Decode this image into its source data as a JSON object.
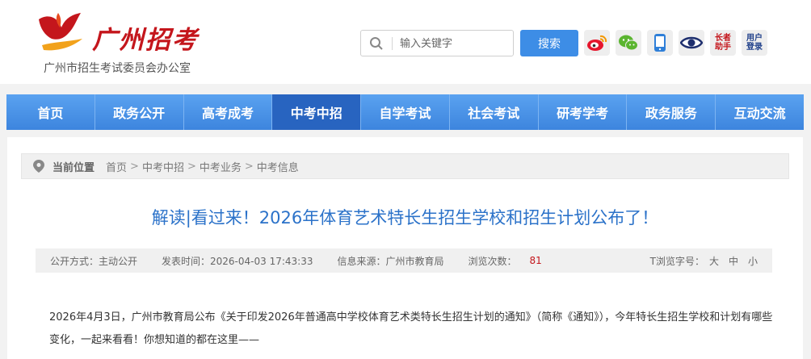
{
  "header": {
    "logo_title": "广州招考",
    "logo_subtitle": "广州市招生考试委员会办公室",
    "search_placeholder": "输入关键字",
    "search_button": "搜索",
    "icons": [
      "weibo-icon",
      "wechat-icon",
      "mobile-icon",
      "eye-icon"
    ],
    "helper_label_top": "长者",
    "helper_label_bottom": "助手",
    "login_label_top": "用户",
    "login_label_bottom": "登录"
  },
  "nav": {
    "items": [
      "首页",
      "政务公开",
      "高考成考",
      "中考中招",
      "自学考试",
      "社会考试",
      "研考学考",
      "政务服务",
      "互动交流"
    ],
    "active_index": 3
  },
  "breadcrumb": {
    "label": "当前位置",
    "items": [
      "首页",
      "中考中招",
      "中考业务",
      "中考信息"
    ],
    "separator": ">"
  },
  "article": {
    "title": "解读|看过来！2026年体育艺术特长生招生学校和招生计划公布了！",
    "meta": {
      "disclosure": "公开方式：主动公开",
      "publish_time": "发表时间：2026-04-03 17:43:33",
      "source": "信息来源：广州市教育局",
      "views_label": "浏览次数：",
      "views": "81",
      "font_label": "T浏览字号：",
      "font_sizes": [
        "大",
        "中",
        "小"
      ]
    },
    "body": "2026年4月3日，广州市教育局公布《关于印发2026年普通高中学校体育艺术类特长生招生计划的通知》（简称《通知》），今年特长生招生学校和计划有哪些变化，一起来看看！你想知道的都在这里——"
  },
  "colors": {
    "brand_red": "#c4161c",
    "nav_blue": "#3d85de",
    "nav_active": "#2864c0",
    "title_blue": "#2b72c9"
  }
}
